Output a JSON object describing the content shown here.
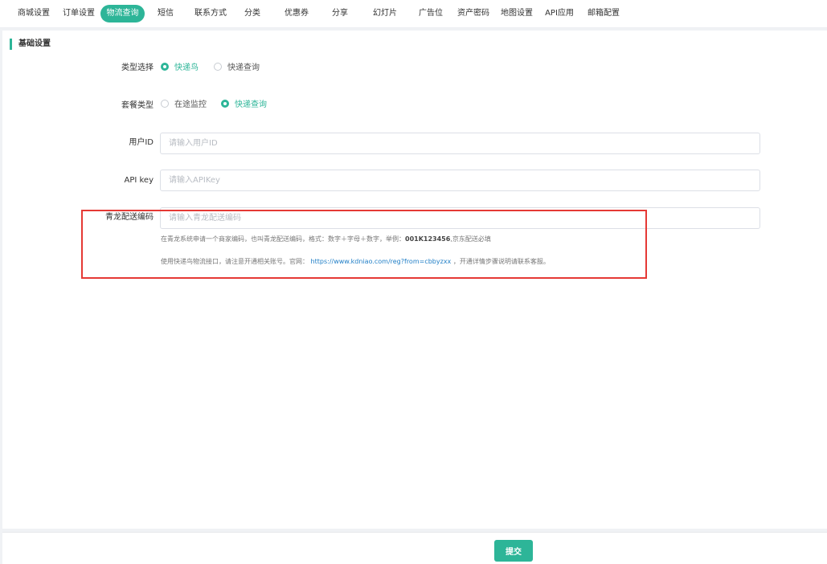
{
  "tabs": [
    {
      "label": "商城设置"
    },
    {
      "label": "订单设置"
    },
    {
      "label": "物流查询",
      "active": true
    },
    {
      "label": "短信"
    },
    {
      "label": "联系方式"
    },
    {
      "label": "分类"
    },
    {
      "label": "优惠券"
    },
    {
      "label": "分享"
    },
    {
      "label": "幻灯片"
    },
    {
      "label": "广告位"
    },
    {
      "label": "资产密码"
    },
    {
      "label": "地图设置"
    },
    {
      "label": "API应用"
    },
    {
      "label": "邮箱配置"
    }
  ],
  "section": {
    "title": "基础设置"
  },
  "form": {
    "type_select": {
      "label": "类型选择",
      "options": [
        {
          "label": "快递鸟",
          "checked": true
        },
        {
          "label": "快递查询",
          "checked": false
        }
      ]
    },
    "package_type": {
      "label": "套餐类型",
      "options": [
        {
          "label": "在途监控",
          "checked": false
        },
        {
          "label": "快递查询",
          "checked": true
        }
      ]
    },
    "user_id": {
      "label": "用户ID",
      "placeholder": "请输入用户ID",
      "value": ""
    },
    "api_key": {
      "label": "API key",
      "placeholder": "请输入APIKey",
      "value": ""
    },
    "qinglong_code": {
      "label": "青龙配送编码",
      "placeholder": "请输入青龙配送编码",
      "value": "",
      "help1_prefix": "在青龙系统申请一个商家编码，也叫青龙配送编码，格式：数字＋字母＋数字，举例：",
      "help1_example": "001K123456",
      "help1_suffix": ",京东配送必填",
      "help2_prefix": "使用快递鸟物流接口，请注意开通相关账号。官网：",
      "help2_link": "https://www.kdniao.com/reg?from=cbbyzxx",
      "help2_suffix": "，开通详情步骤说明请联系客服。"
    }
  },
  "footer": {
    "submit_label": "提交"
  },
  "colors": {
    "accent": "#2db598",
    "highlight_border": "#e53935",
    "link": "#1f7ec6"
  }
}
